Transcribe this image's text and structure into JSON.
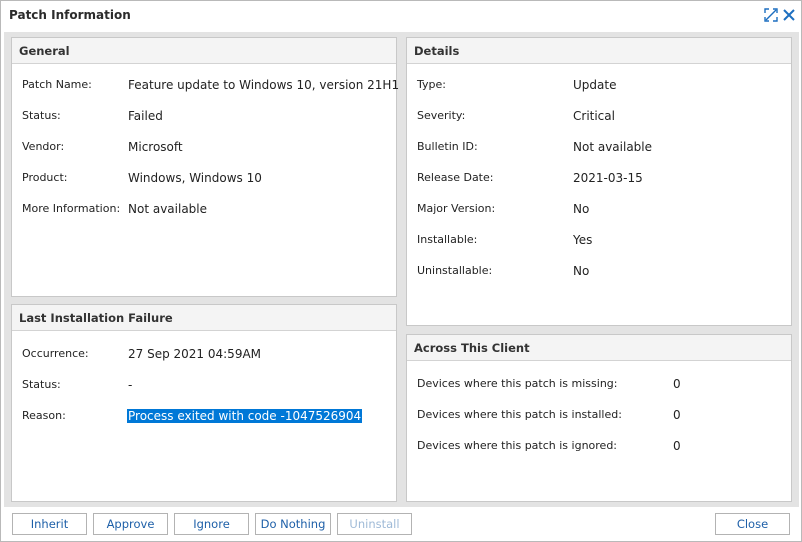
{
  "window": {
    "title": "Patch Information"
  },
  "general": {
    "title": "General",
    "rows": [
      {
        "label": "Patch Name:",
        "value": "Feature update to Windows 10, version 21H1"
      },
      {
        "label": "Status:",
        "value": "Failed"
      },
      {
        "label": "Vendor:",
        "value": "Microsoft"
      },
      {
        "label": "Product:",
        "value": "Windows, Windows 10"
      },
      {
        "label": "More Information:",
        "value": "Not available"
      }
    ]
  },
  "details": {
    "title": "Details",
    "rows": [
      {
        "label": "Type:",
        "value": "Update"
      },
      {
        "label": "Severity:",
        "value": "Critical"
      },
      {
        "label": "Bulletin ID:",
        "value": "Not available"
      },
      {
        "label": "Release Date:",
        "value": "2021-03-15"
      },
      {
        "label": "Major Version:",
        "value": "No"
      },
      {
        "label": "Installable:",
        "value": "Yes"
      },
      {
        "label": "Uninstallable:",
        "value": "No"
      }
    ]
  },
  "failure": {
    "title": "Last Installation Failure",
    "rows": [
      {
        "label": "Occurrence:",
        "value": "27 Sep 2021 04:59AM"
      },
      {
        "label": "Status:",
        "value": "-"
      },
      {
        "label": "Reason:",
        "value": "Process exited with code -1047526904"
      }
    ]
  },
  "client": {
    "title": "Across This Client",
    "rows": [
      {
        "label": "Devices where this patch is missing:",
        "value": "0"
      },
      {
        "label": "Devices where this patch is installed:",
        "value": "0"
      },
      {
        "label": "Devices where this patch is ignored:",
        "value": "0"
      }
    ]
  },
  "buttons": {
    "inherit": "Inherit",
    "approve": "Approve",
    "ignore": "Ignore",
    "do_nothing": "Do Nothing",
    "uninstall": "Uninstall",
    "close": "Close"
  },
  "colors": {
    "accent": "#1d5fa8",
    "selection": "#0078d7",
    "panel_gap": "#e3e3e3"
  }
}
